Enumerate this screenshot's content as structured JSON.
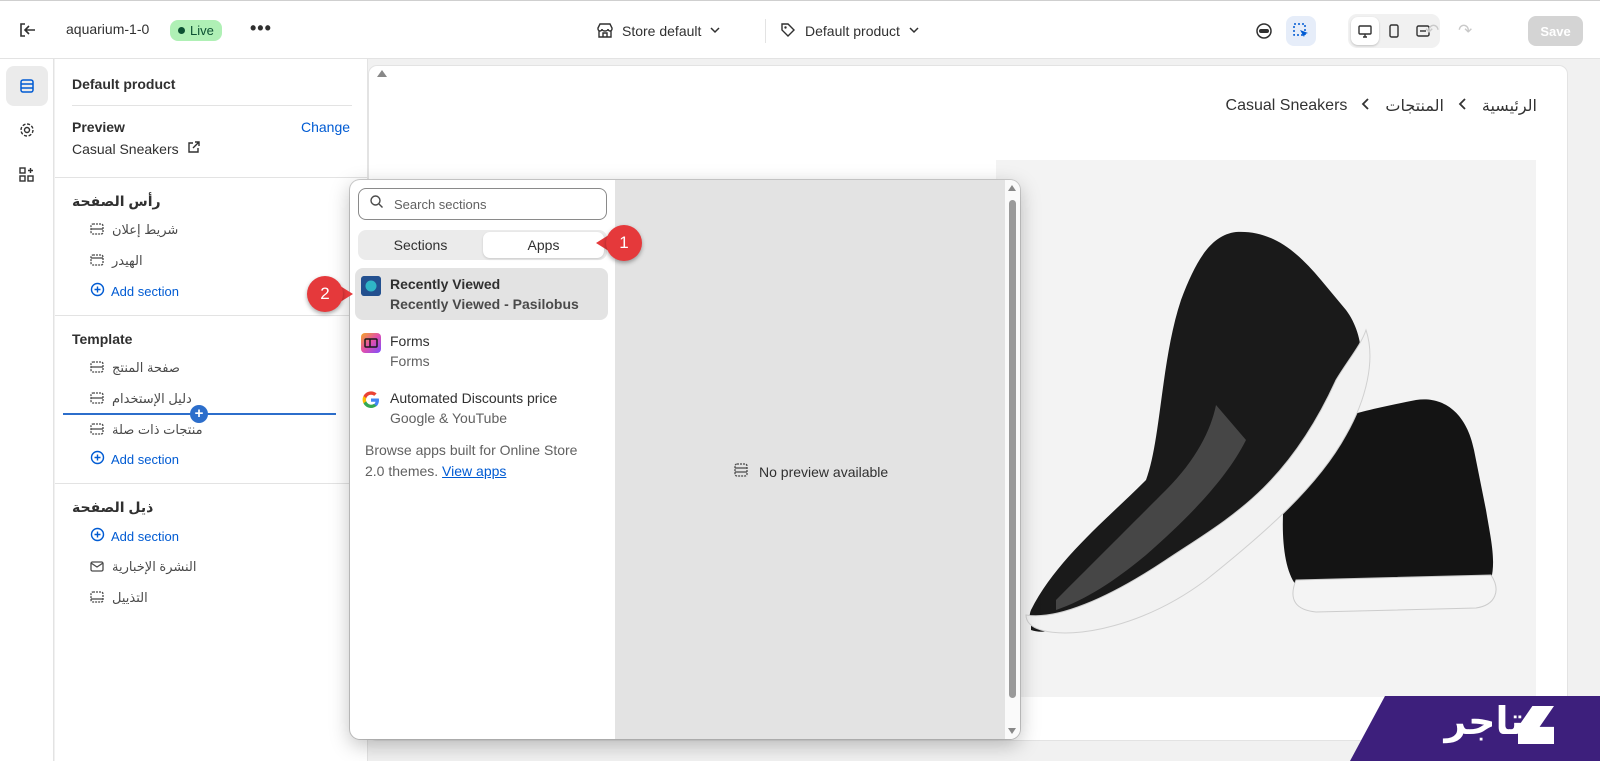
{
  "topbar": {
    "store_name": "aquarium-1-0",
    "live_badge": "Live",
    "more_label": "•••",
    "store_select": "Store default",
    "template_select": "Default product",
    "save_label": "Save"
  },
  "sidebar": {
    "title": "Default product",
    "preview_label": "Preview",
    "change_label": "Change",
    "preview_product": "Casual Sneakers",
    "groups": [
      {
        "title": "رأس الصفحة",
        "items": [
          "شريط إعلان",
          "الهيدر"
        ],
        "add_label": "Add section"
      },
      {
        "title": "Template",
        "items": [
          "صفحة المنتج",
          "دليل الإستخدام",
          "منتجات ذات صلة"
        ],
        "add_label": "Add section"
      },
      {
        "title": "ذيل الصفحة",
        "add_label": "Add section",
        "items": [
          "النشرة الإخبارية",
          "التذييل"
        ]
      }
    ]
  },
  "canvas": {
    "breadcrumb": [
      "الرئيسية",
      "المنتجات",
      "Casual Sneakers"
    ]
  },
  "picker": {
    "search_placeholder": "Search sections",
    "tabs": [
      "Sections",
      "Apps"
    ],
    "active_tab": "Apps",
    "apps": [
      {
        "name": "Recently Viewed",
        "vendor": "Recently Viewed - Pasilobus",
        "icon": "recently-viewed-logo"
      },
      {
        "name": "Forms",
        "vendor": "Forms",
        "icon": "forms-logo"
      },
      {
        "name": "Automated Discounts price",
        "vendor": "Google & YouTube",
        "icon": "google-logo"
      }
    ],
    "browse_text": "Browse apps built for Online Store 2.0 themes.",
    "browse_link": "View apps",
    "no_preview": "No preview available"
  },
  "callouts": [
    "1",
    "2"
  ],
  "brand": {
    "text": "تاجر",
    "color": "#3d1f7c"
  },
  "colors": {
    "accent": "#005bd3",
    "live": "#aff0b5",
    "callout": "#e5393b"
  }
}
